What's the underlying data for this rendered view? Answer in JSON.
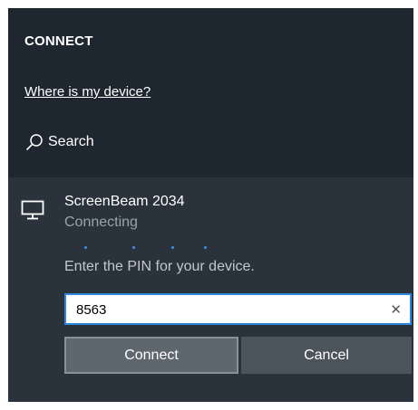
{
  "panel": {
    "title": "CONNECT",
    "help_link": "Where is my device?",
    "search_label": "Search",
    "search_icon": "search-icon"
  },
  "device": {
    "icon": "monitor-icon",
    "name": "ScreenBeam 2034",
    "status": "Connecting",
    "pin_prompt": "Enter the PIN for your device.",
    "pin_value": "8563",
    "clear_icon": "close-icon",
    "connect_label": "Connect",
    "cancel_label": "Cancel"
  },
  "colors": {
    "panel_bg": "#1e2730",
    "card_bg": "#2a333c",
    "accent": "#2e86de",
    "progress_dot": "#3d8fe0"
  }
}
